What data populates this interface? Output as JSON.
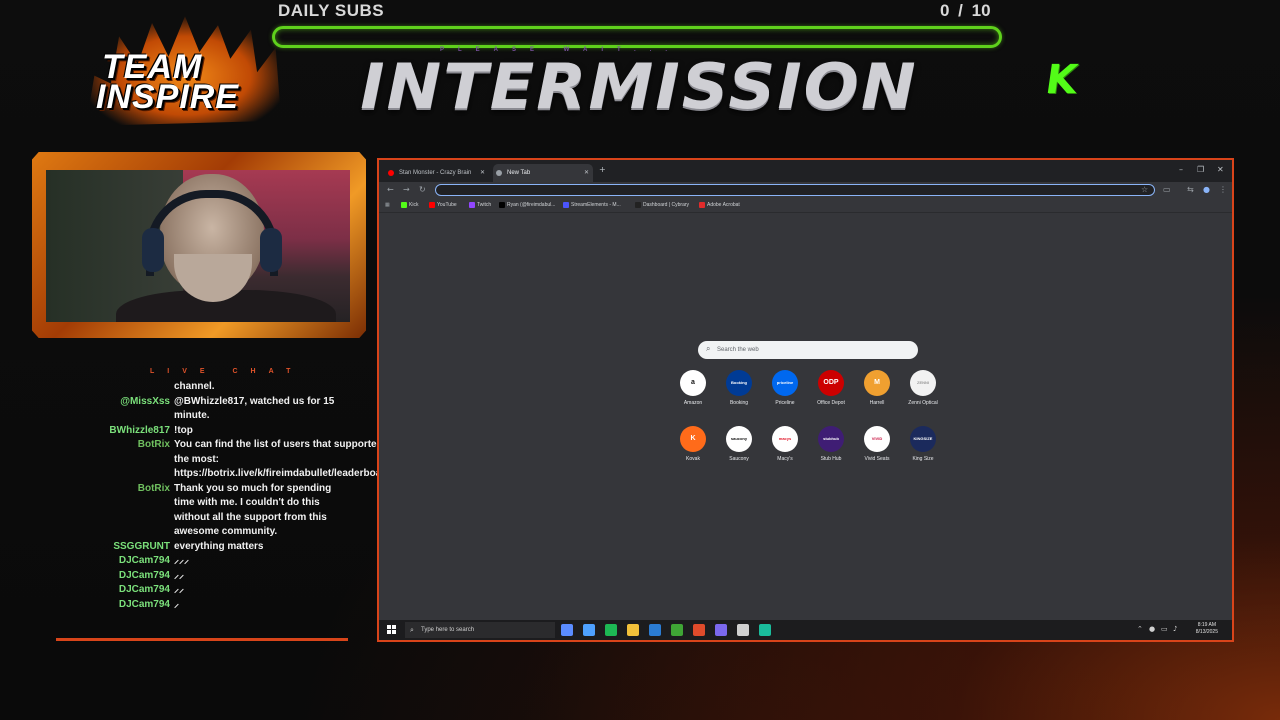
{
  "overlay": {
    "logo": {
      "line1": "TEAM",
      "line2": "INSPIRE"
    },
    "subs": {
      "label": "DAILY SUBS",
      "count": "0  / 10",
      "progress_fraction": 0
    },
    "please_wait": "PLEASE WAIT...",
    "title": "INTERMISSION",
    "kick_logo": "K"
  },
  "chat": {
    "title": "LIVE CHAT",
    "colors": {
      "user_green": "#7be07b",
      "bot": "#6fbf5f",
      "text": "#f1f1f1"
    },
    "messages": [
      {
        "user": "",
        "text": "channel."
      },
      {
        "user": "@MissXss",
        "text": "@BWhizzle817, watched us for 15 minute."
      },
      {
        "user": "BWhizzle817",
        "text": "!top"
      },
      {
        "user": "BotRix",
        "text": "You can find the list of users that supported the most: https://botrix.live/k/fireimdabullet/leaderboard"
      },
      {
        "user": "BotRix",
        "text": "Thank you so much for spending time with me. I couldn't do this without all the support from this awesome community."
      },
      {
        "user": "SSGGRUNT",
        "text": "everything matters"
      },
      {
        "user": "DJCam794",
        "text": "⸝⸝⸝"
      },
      {
        "user": "DJCam794",
        "text": "⸝⸝"
      },
      {
        "user": "DJCam794",
        "text": "⸝⸝"
      },
      {
        "user": "DJCam794",
        "text": "⸝"
      }
    ]
  },
  "browser": {
    "tabs": [
      {
        "label": "Stan Monster - Crazy Brain",
        "icon_color": "#ff0000",
        "active": false
      },
      {
        "label": "New Tab",
        "icon_color": "#9aa0a6",
        "active": true
      }
    ],
    "new_tab_symbol": "+",
    "window_controls": {
      "minimize": "–",
      "restore": "❐",
      "close": "✕"
    },
    "bookmarks": [
      {
        "label": "Kick",
        "color": "#53fc18"
      },
      {
        "label": "YouTube",
        "color": "#ff0000"
      },
      {
        "label": "Twitch",
        "color": "#9146ff"
      },
      {
        "label": "Ryan (@fireimdabul...",
        "color": "#000000"
      },
      {
        "label": "StreamElements - M...",
        "color": "#4b55ff"
      },
      {
        "label": "Dashboard | Cybrary",
        "color": "#222222"
      },
      {
        "label": "Adobe Acrobat",
        "color": "#e12b2b"
      }
    ],
    "search_placeholder": "Search the web",
    "shortcuts": [
      {
        "label": "Amazon",
        "mark": "a",
        "bg": "#ffffff",
        "fg": "#111111"
      },
      {
        "label": "Booking",
        "mark": "Booking",
        "bg": "#003b95",
        "fg": "#ffffff"
      },
      {
        "label": "Priceline",
        "mark": "priceline",
        "bg": "#0068ef",
        "fg": "#ffffff"
      },
      {
        "label": "Office Depot",
        "mark": "ODP",
        "bg": "#cc0000",
        "fg": "#ffffff"
      },
      {
        "label": "Harrell",
        "mark": "M",
        "bg": "#f0a030",
        "fg": "#ffffff"
      },
      {
        "label": "Zenni Optical",
        "mark": "ZENNI",
        "bg": "#f2f2f2",
        "fg": "#999999"
      },
      {
        "label": "Kovak",
        "mark": "K",
        "bg": "#ff6b1a",
        "fg": "#ffffff"
      },
      {
        "label": "Saucony",
        "mark": "saucony",
        "bg": "#ffffff",
        "fg": "#111111"
      },
      {
        "label": "Macy's",
        "mark": "macys",
        "bg": "#ffffff",
        "fg": "#e21a2c"
      },
      {
        "label": "Stub Hub",
        "mark": "stubhub",
        "bg": "#3f1d74",
        "fg": "#ffffff"
      },
      {
        "label": "Vivid Seats",
        "mark": "VIVID",
        "bg": "#ffffff",
        "fg": "#c8103e"
      },
      {
        "label": "King Size",
        "mark": "KINGSIZE",
        "bg": "#1b2a5c",
        "fg": "#ffffff"
      }
    ],
    "taskbar": {
      "search_placeholder": "Type here to search",
      "time": "8:19 AM",
      "date": "8/13/2025",
      "apps": [
        "#5b8cff",
        "#4ea1ff",
        "#1db954",
        "#f3c13a",
        "#2b7cd3",
        "#3fa535",
        "#e04b2b",
        "#7b68ee",
        "#d0d0d0",
        "#1abc9c"
      ]
    }
  }
}
